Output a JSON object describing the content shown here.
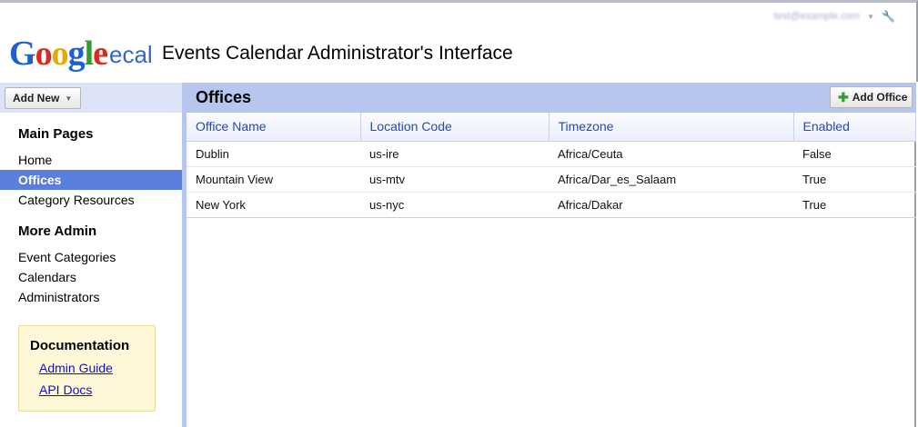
{
  "account": {
    "email": "test@example.com",
    "menu_icon": "caret-down-icon",
    "settings_icon": "wrench-icon"
  },
  "header": {
    "logo_letters": [
      "G",
      "o",
      "o",
      "g",
      "l",
      "e"
    ],
    "logo_sub": "ecal",
    "title": "Events Calendar Administrator's Interface"
  },
  "toolbar": {
    "add_new_label": "Add New"
  },
  "sidebar": {
    "main_pages_heading": "Main Pages",
    "main_pages": [
      {
        "label": "Home",
        "active": false
      },
      {
        "label": "Offices",
        "active": true
      },
      {
        "label": "Category Resources",
        "active": false
      }
    ],
    "more_admin_heading": "More Admin",
    "more_admin": [
      {
        "label": "Event Categories"
      },
      {
        "label": "Calendars"
      },
      {
        "label": "Administrators"
      }
    ],
    "documentation": {
      "title": "Documentation",
      "links": [
        "Admin Guide",
        "API Docs"
      ]
    }
  },
  "main": {
    "title": "Offices",
    "add_button_label": "Add Office",
    "table": {
      "columns": [
        "Office Name",
        "Location Code",
        "Timezone",
        "Enabled"
      ],
      "rows": [
        [
          "Dublin",
          "us-ire",
          "Africa/Ceuta",
          "False"
        ],
        [
          "Mountain View",
          "us-mtv",
          "Africa/Dar_es_Salaam",
          "True"
        ],
        [
          "New York",
          "us-nyc",
          "Africa/Dakar",
          "True"
        ]
      ]
    }
  },
  "colors": {
    "nav_active": "#5a7edc",
    "panel_header": "#b7c6ee",
    "link": "#1010cc",
    "column_header_text": "#2a4aa8"
  }
}
